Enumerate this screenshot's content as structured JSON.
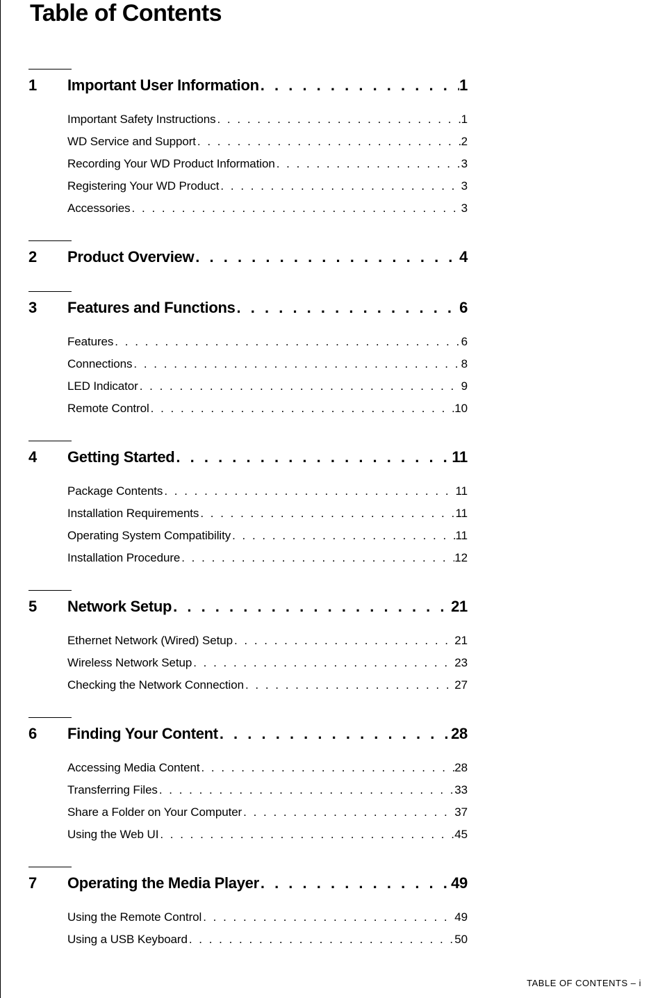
{
  "title": "Table of Contents",
  "footer": "TABLE OF CONTENTS – i",
  "dots": ". . . . . . . . . . . . . . . . . . . . . . . . . . . . . . . . . . . . . . . . . . . . . . . . . . . . . . . . . . . . . . . . . . . . . . . . . . . . . . . . . . . . . . . . . . . . . . . . . . . . . . . . . . . . . . . . . . . . . . . .",
  "chapters": [
    {
      "num": "1",
      "title": "Important User Information",
      "page": "1",
      "subs": [
        {
          "title": "Important Safety Instructions",
          "page": "1"
        },
        {
          "title": "WD Service and Support",
          "page": "2"
        },
        {
          "title": "Recording Your WD Product Information ",
          "page": "3"
        },
        {
          "title": "Registering Your WD Product ",
          "page": "3"
        },
        {
          "title": "Accessories ",
          "page": "3"
        }
      ]
    },
    {
      "num": "2",
      "title": "Product Overview",
      "page": "4",
      "subs": []
    },
    {
      "num": "3",
      "title": "Features and Functions",
      "page": "6",
      "subs": [
        {
          "title": "Features",
          "page": "6"
        },
        {
          "title": "Connections  ",
          "page": "8"
        },
        {
          "title": "LED Indicator",
          "page": "9"
        },
        {
          "title": "Remote Control",
          "page": "10"
        }
      ]
    },
    {
      "num": "4",
      "title": "Getting Started ",
      "page": "11",
      "subs": [
        {
          "title": "Package Contents ",
          "page": "11"
        },
        {
          "title": "Installation Requirements ",
          "page": "11"
        },
        {
          "title": "Operating System Compatibility ",
          "page": "11"
        },
        {
          "title": "Installation Procedure",
          "page": "12"
        }
      ]
    },
    {
      "num": "5",
      "title": "Network Setup",
      "page": "21",
      "subs": [
        {
          "title": "Ethernet Network (Wired) Setup",
          "page": "21"
        },
        {
          "title": "Wireless Network Setup",
          "page": "23"
        },
        {
          "title": "Checking the Network Connection",
          "page": "27"
        }
      ]
    },
    {
      "num": "6",
      "title": "Finding Your Content",
      "page": "28",
      "subs": [
        {
          "title": "Accessing Media Content ",
          "page": "28"
        },
        {
          "title": "Transferring Files",
          "page": "33"
        },
        {
          "title": "Share a Folder on Your Computer",
          "page": "37"
        },
        {
          "title": "Using the Web UI",
          "page": "45"
        }
      ]
    },
    {
      "num": "7",
      "title": "Operating the Media Player",
      "page": "49",
      "subs": [
        {
          "title": "Using the Remote Control",
          "page": "49"
        },
        {
          "title": "Using a USB Keyboard ",
          "page": "50"
        }
      ]
    }
  ]
}
